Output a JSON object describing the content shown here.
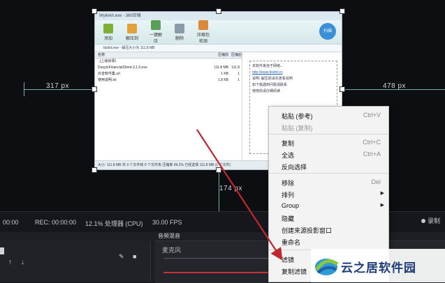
{
  "guides": {
    "left_px": "317 px",
    "right_px": "478 px",
    "bottom_px": "174 px"
  },
  "window": {
    "title": "Wyliekh.exe - 360压缩",
    "toolbar": [
      {
        "label": "添加",
        "color": "#7fae3a"
      },
      {
        "label": "解压到",
        "color": "#e0a23a"
      },
      {
        "label": "一键解压",
        "color": "#5aa05a"
      },
      {
        "label": "删除",
        "color": "#8a9aa6"
      },
      {
        "label": "压缩包检测",
        "color": "#d98a3a"
      }
    ],
    "badge": "扫描",
    "address": "ttsdrd.exe - 解压大小为 111.8 MB",
    "columns": [
      "名称",
      "压缩前",
      "压缩后"
    ],
    "files": [
      {
        "name": "..(上级目录)",
        "size": "",
        "packed": ""
      },
      {
        "name": "DouyinFinancialClient-3.1.0.exe",
        "size": "111.8 MB",
        "packed": "111.8"
      },
      {
        "name": "抖音软件集.url",
        "size": "1 KB",
        "packed": "1"
      },
      {
        "name": "使用说明.txt",
        "size": "1.8 KB",
        "packed": "1"
      }
    ],
    "right_lines": [
      "本软件来自于网络...",
      "说明: 解压前请先查看说明",
      "如下载遇到问题请联系",
      "使用前请仔细阅读"
    ],
    "right_link": "http://www.ttsdrd.cn",
    "status": "大小: 111.8 MB 共 3 个文件和 0 个文件夹 压缩率 99.2% 已经选择 111.8 MB (1 个文件)"
  },
  "statusbar": {
    "time": "00:00",
    "rec": "REC: 00:00:00",
    "cpu": "12.1% 处理器 (CPU)",
    "fps": "30.00 FPS",
    "right_label": "录制"
  },
  "mixer": {
    "title": "音频混音",
    "channel": "麦克风"
  },
  "context_menu": {
    "items": [
      {
        "label": "粘贴 (参考)",
        "shortcut": "Ctrl+V",
        "disabled": false,
        "submenu": false
      },
      {
        "label": "粘贴 (复制)",
        "shortcut": "",
        "disabled": true,
        "submenu": false
      },
      {
        "label": "复制",
        "shortcut": "Ctrl+C",
        "disabled": false,
        "submenu": false
      },
      {
        "label": "全选",
        "shortcut": "Ctrl+A",
        "disabled": false,
        "submenu": false
      },
      {
        "label": "反向选择",
        "shortcut": "",
        "disabled": false,
        "submenu": false
      },
      {
        "label": "移除",
        "shortcut": "Del",
        "disabled": false,
        "submenu": false
      },
      {
        "label": "排列",
        "shortcut": "",
        "disabled": false,
        "submenu": true
      },
      {
        "label": "Group",
        "shortcut": "",
        "disabled": false,
        "submenu": true
      },
      {
        "label": "隐藏",
        "shortcut": "",
        "disabled": false,
        "submenu": false
      },
      {
        "label": "创建来源投影窗口",
        "shortcut": "",
        "disabled": false,
        "submenu": false
      },
      {
        "label": "重命名",
        "shortcut": "",
        "disabled": false,
        "submenu": false
      },
      {
        "label": "滤镜",
        "shortcut": "",
        "disabled": false,
        "submenu": false
      },
      {
        "label": "复制滤镜",
        "shortcut": "",
        "disabled": false,
        "submenu": false
      }
    ]
  },
  "watermark": {
    "text": "云之居软件园"
  },
  "colors": {
    "guide": "#6fb0a8",
    "arrow": "#c0282f",
    "menu_bg": "#f3f3f3"
  }
}
